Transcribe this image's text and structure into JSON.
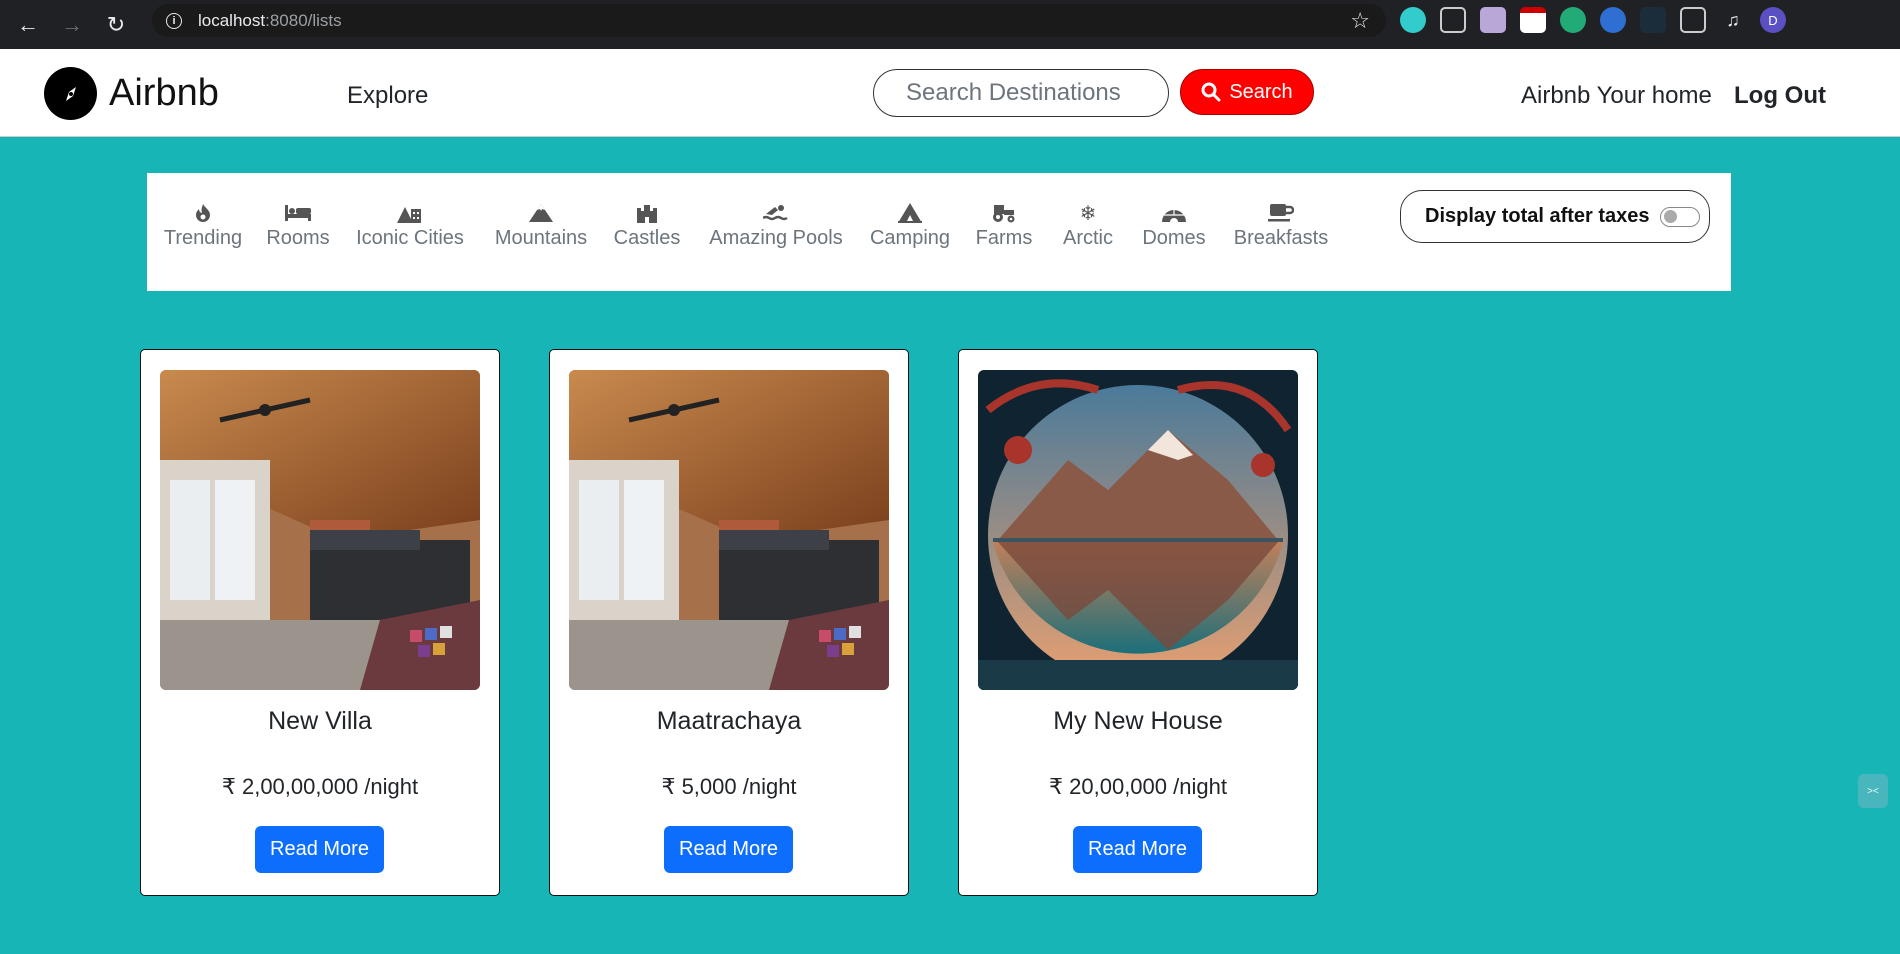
{
  "browser": {
    "url_host": "localhost",
    "url_rest": ":8080/lists",
    "profile_initial": "D"
  },
  "navbar": {
    "brand": "Airbnb",
    "explore": "Explore",
    "search_placeholder": "Search Destinations",
    "search_button": "Search",
    "home_link": "Airbnb Your home",
    "logout": "Log Out"
  },
  "filters": {
    "items": [
      {
        "label": "Trending",
        "icon": "flame-icon"
      },
      {
        "label": "Rooms",
        "icon": "bed-icon"
      },
      {
        "label": "Iconic Cities",
        "icon": "city-icon"
      },
      {
        "label": "Mountains",
        "icon": "mountain-icon"
      },
      {
        "label": "Castles",
        "icon": "castle-icon"
      },
      {
        "label": "Amazing Pools",
        "icon": "swimmer-icon"
      },
      {
        "label": "Camping",
        "icon": "tent-icon"
      },
      {
        "label": "Farms",
        "icon": "tractor-icon"
      },
      {
        "label": "Arctic",
        "icon": "snowflake-icon"
      },
      {
        "label": "Domes",
        "icon": "igloo-icon"
      },
      {
        "label": "Breakfasts",
        "icon": "mug-icon"
      }
    ],
    "tax_toggle_label": "Display total after taxes"
  },
  "listings": [
    {
      "title": "New Villa",
      "price": "₹ 2,00,00,000 /night",
      "button": "Read More",
      "image": "villa-bedroom-image"
    },
    {
      "title": "Maatrachaya",
      "price": "₹ 5,000 /night",
      "button": "Read More",
      "image": "villa-bedroom-image"
    },
    {
      "title": "My New House",
      "price": "₹ 20,00,000 /night",
      "button": "Read More",
      "image": "mountain-lake-image"
    }
  ],
  "colors": {
    "background": "#17b5b5",
    "search_button": "#ff0000",
    "read_more": "#0d6efd"
  }
}
